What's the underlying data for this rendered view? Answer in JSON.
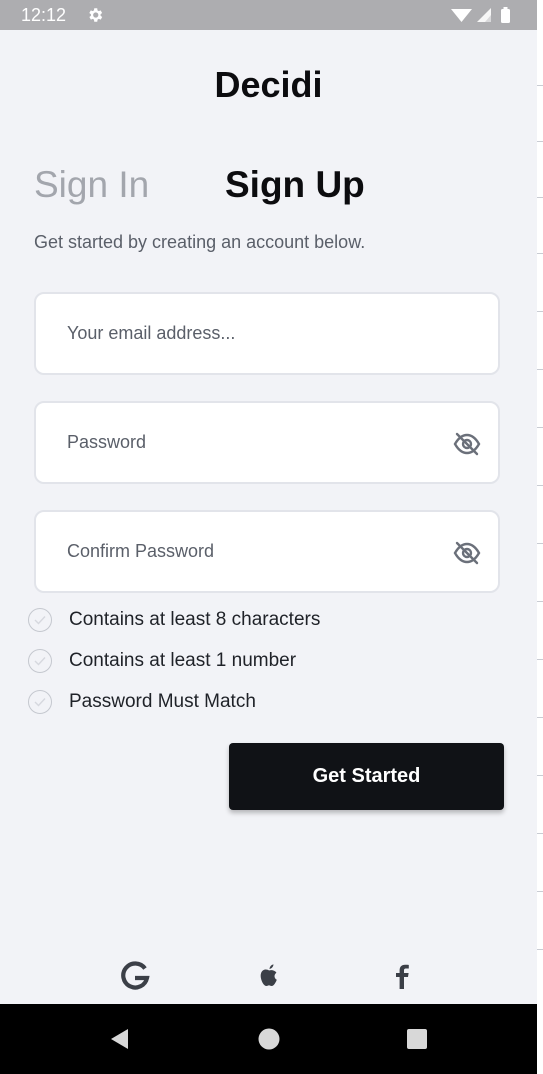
{
  "status_bar": {
    "time": "12:12",
    "settings_icon": "gear-icon",
    "wifi_icon": "wifi-icon",
    "signal_icon": "signal-icon",
    "battery_icon": "battery-icon"
  },
  "app": {
    "title": "Decidi"
  },
  "tabs": {
    "sign_in": "Sign In",
    "sign_up": "Sign Up",
    "active": "Sign Up"
  },
  "subtitle": "Get started by creating an account below.",
  "form": {
    "email": {
      "value": "",
      "placeholder": "Your email address..."
    },
    "password": {
      "value": "",
      "placeholder": "Password",
      "toggle_icon": "eye-off-icon"
    },
    "confirm_password": {
      "value": "",
      "placeholder": "Confirm Password",
      "toggle_icon": "eye-off-icon"
    }
  },
  "requirements": [
    {
      "label": "Contains at least 8 characters",
      "met": false
    },
    {
      "label": "Contains at least 1 number",
      "met": false
    },
    {
      "label": "Password Must Match",
      "met": false
    }
  ],
  "cta": {
    "label": "Get Started"
  },
  "social": [
    {
      "icon": "google-icon"
    },
    {
      "icon": "apple-icon"
    },
    {
      "icon": "facebook-icon"
    }
  ],
  "nav": {
    "back_icon": "back-triangle-icon",
    "home_icon": "home-circle-icon",
    "recents_icon": "recents-square-icon"
  },
  "colors": {
    "background": "#f2f3f7",
    "primary_text": "#0c0c0f",
    "inactive_tab": "#a3a6ad",
    "secondary_text": "#5a5f69",
    "button": "#101216",
    "button_text": "#ffffff",
    "status_bar": "#adadb0",
    "nav_bar": "#000000"
  }
}
